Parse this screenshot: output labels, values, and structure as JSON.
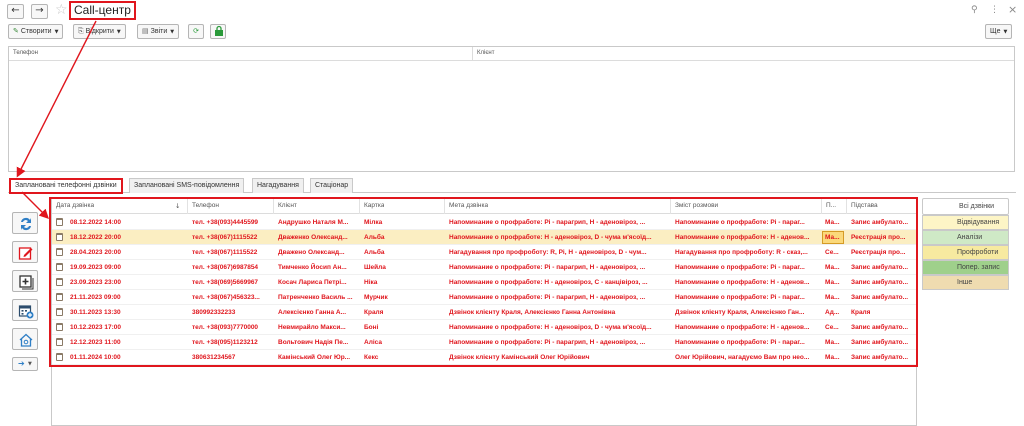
{
  "window": {
    "title": "Call-центр",
    "back_icon": "←",
    "forward_icon": "→",
    "star_icon": "☆",
    "link_icon": "⚲",
    "more_icon": "⋮",
    "close_icon": "×"
  },
  "toolbar": {
    "create_label": "Створити",
    "open_label": "Відкрити",
    "reports_label": "Звіти",
    "refresh_icon": "⟳",
    "lock_icon": "🔒",
    "more_label": "Ще"
  },
  "upper_table": {
    "columns": [
      "Телефон",
      "Клієнт"
    ]
  },
  "tabs": [
    {
      "label": "Заплановані телефонні дзвінки",
      "active": true
    },
    {
      "label": "Заплановані SMS-повідомлення",
      "active": false
    },
    {
      "label": "Нагадування",
      "active": false
    },
    {
      "label": "Стаціонар",
      "active": false
    }
  ],
  "main_table": {
    "columns": [
      "Дата дзвінка",
      "Телефон",
      "Клієнт",
      "Картка",
      "Мета дзвінка",
      "Зміст розмови",
      "П...",
      "Підстава"
    ],
    "sort_icon": "↓",
    "rows": [
      {
        "date": "08.12.2022 14:00",
        "phone": "тел. +38(093)4445599",
        "client": "Андрушко Наталя М...",
        "card": "Мілка",
        "purpose": "Напоминание о профработе: Рі - парагрип, Н - аденовіроз, ...",
        "content": "Напоминание о профработе: Рі - параг...",
        "p": "Ма...",
        "basis": "Запис амбулато..."
      },
      {
        "date": "18.12.2022 20:00",
        "phone": "тел. +38(067)1115522",
        "client": "Дваженко Олександ...",
        "card": "Альба",
        "purpose": "Напоминание о профработе: Н - аденовіроз, D - чума м'ясоїд...",
        "content": "Напоминание о профработе: Н - аденов...",
        "p": "Ма...",
        "basis": "Реєстрація про..."
      },
      {
        "date": "28.04.2023 20:00",
        "phone": "тел. +38(067)1115522",
        "client": "Дважено Олександ...",
        "card": "Альба",
        "purpose": "Нагадування про профроботу: R, Рі, Н - аденовіроз, D - чум...",
        "content": "Нагадування про профроботу: R - сказ,...",
        "p": "Се...",
        "basis": "Реєстрація про..."
      },
      {
        "date": "19.09.2023 09:00",
        "phone": "тел. +38(067)6987854",
        "client": "Тимченко Йосип Ан...",
        "card": "Шейла",
        "purpose": "Напоминание о профработе: Рі - парагрип, Н - аденовіроз, ...",
        "content": "Напоминание о профработе: Рі - параг...",
        "p": "Ма...",
        "basis": "Запис амбулато..."
      },
      {
        "date": "23.09.2023 23:00",
        "phone": "тел. +38(069)5669967",
        "client": "Косач Лариса Петрі...",
        "card": "Ніка",
        "purpose": "Напоминание о профработе: Н - аденовіроз, С - канцівіроз, ...",
        "content": "Напоминание о профработе: Н - аденов...",
        "p": "Ма...",
        "basis": "Запис амбулато..."
      },
      {
        "date": "21.11.2023 09:00",
        "phone": "тел. +38(067)456323...",
        "client": "Патренченко Василь ...",
        "card": "Мурчик",
        "purpose": "Напоминание о профработе: Рі - парагрип, Н - аденовіроз, ...",
        "content": "Напоминание о профработе: Рі - параг...",
        "p": "Ма...",
        "basis": "Запис амбулато..."
      },
      {
        "date": "30.11.2023 13:30",
        "phone": "380992332233",
        "client": "Алексієнко Ганна А...",
        "card": "Краля",
        "purpose": "Дзвінок клієнту Краля, Алексієнко Ганна Антонівна",
        "content": "Дзвінок клієнту Краля, Алексієнко Ган...",
        "p": "Ад...",
        "basis": "Краля"
      },
      {
        "date": "10.12.2023 17:00",
        "phone": "тел. +38(093)7770000",
        "client": "Невмирайло Макси...",
        "card": "Боні",
        "purpose": "Напоминание о профработе: Н - аденовіроз, D - чума м'ясоїд...",
        "content": "Напоминание о профработе: Н - аденов...",
        "p": "Се...",
        "basis": "Запис амбулато..."
      },
      {
        "date": "12.12.2023 11:00",
        "phone": "тел. +38(095)1123212",
        "client": "Вольтович Надія Пе...",
        "card": "Аліса",
        "purpose": "Напоминание о профработе: Рі - парагрип, Н - аденовіроз, ...",
        "content": "Напоминание о профработе: Рі - параг...",
        "p": "Ма...",
        "basis": "Запис амбулато..."
      },
      {
        "date": "01.11.2024 10:00",
        "phone": "380631234567",
        "client": "Камінський Олег Юр...",
        "card": "Кекс",
        "purpose": "Дзвінок клієнту Камінський Олег Юрійович",
        "content": "Олег Юрійович, нагадуємо Вам про нео...",
        "p": "Ма...",
        "basis": "Запис амбулато..."
      }
    ]
  },
  "filters": [
    {
      "label": "Всі дзвінки",
      "color": "#ffffff"
    },
    {
      "label": "Відвідування",
      "color": "#fdf5c6"
    },
    {
      "label": "Аналізи",
      "color": "#cfe9c6"
    },
    {
      "label": "Профроботи",
      "color": "#f7eaa0"
    },
    {
      "label": "Попер. запис",
      "color": "#9fd08b"
    },
    {
      "label": "Інше",
      "color": "#efdcb0"
    }
  ],
  "colors": {
    "accent_red": "#e0161d",
    "selected_row": "#fbeec2"
  }
}
